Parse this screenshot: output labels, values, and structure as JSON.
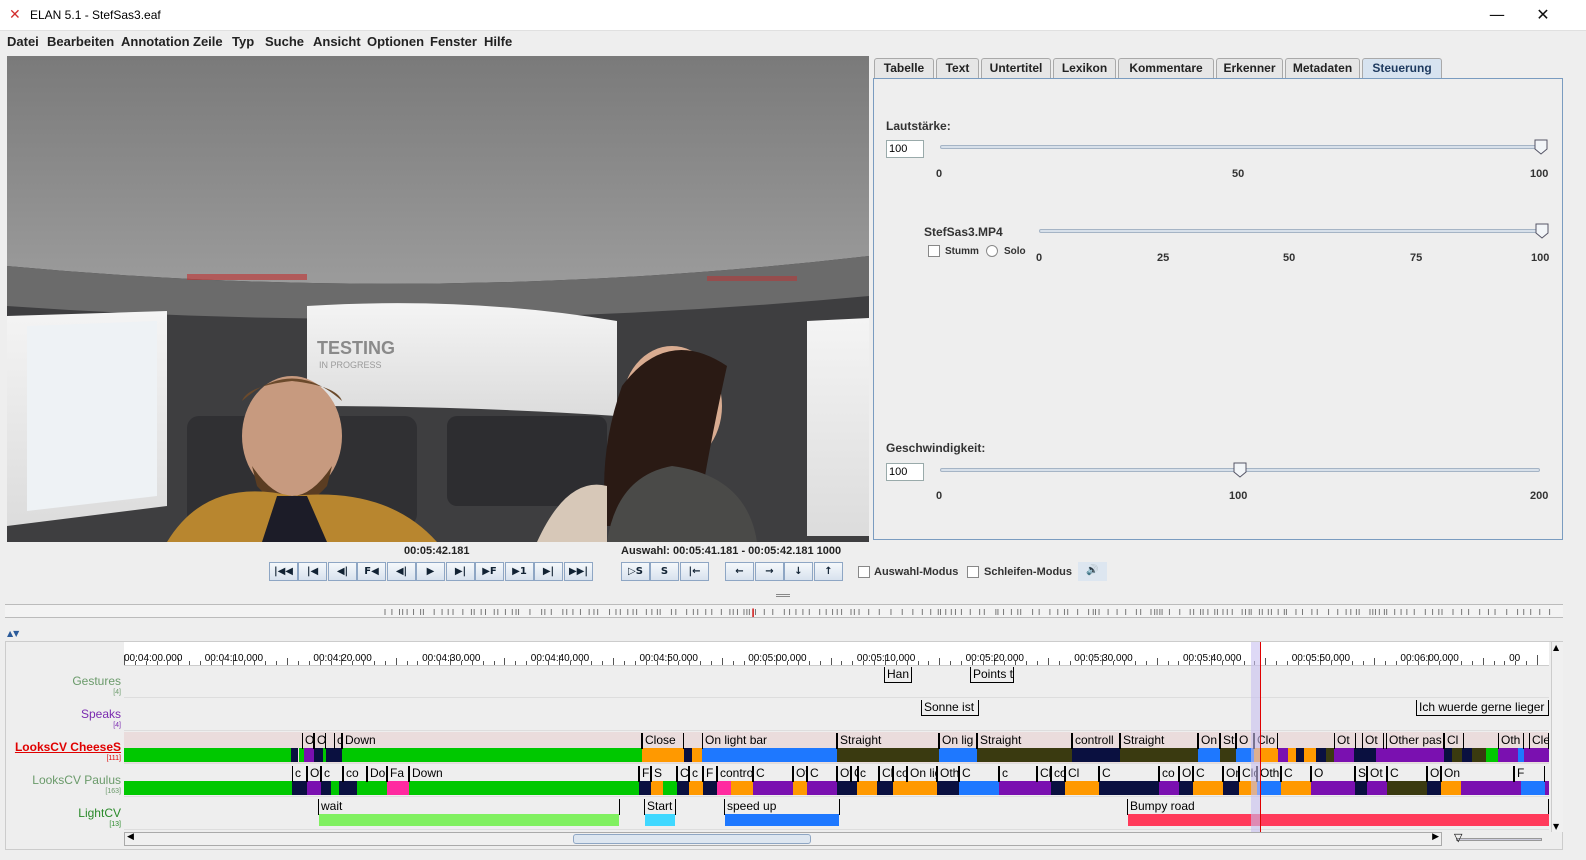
{
  "window": {
    "title": "ELAN 5.1 - StefSas3.eaf",
    "minimize": "—",
    "maximize": "☐",
    "close": "✕"
  },
  "menu": [
    "Datei",
    "Bearbeiten",
    "Annotation",
    "Zeile",
    "Typ",
    "Suche",
    "Ansicht",
    "Optionen",
    "Fenster",
    "Hilfe"
  ],
  "video": {
    "sign_line1": "TESTING",
    "sign_line2": "IN PROGRESS"
  },
  "tabs": [
    "Tabelle",
    "Text",
    "Untertitel",
    "Lexikon",
    "Kommentare",
    "Erkenner",
    "Metadaten",
    "Steuerung"
  ],
  "active_tab": "Steuerung",
  "controls": {
    "volume_label": "Lautstärke:",
    "volume_value": "100",
    "volume_ticks": [
      "0",
      "50",
      "100"
    ],
    "media_name": "StefSas3.MP4",
    "mute_label": "Stumm",
    "solo_label": "Solo",
    "media_ticks": [
      "0",
      "25",
      "50",
      "75",
      "100"
    ],
    "speed_label": "Geschwindigkeit:",
    "speed_value": "100",
    "speed_ticks": [
      "0",
      "100",
      "200"
    ]
  },
  "player": {
    "current_time": "00:05:42.181",
    "selection": "Auswahl: 00:05:41.181 - 00:05:42.181  1000",
    "auswahl_modus": "Auswahl-Modus",
    "schleifen_modus": "Schleifen-Modus",
    "buttons": [
      "|◀◀",
      "|◀",
      "◀|",
      "F◀",
      "◀|",
      "▶",
      "▶|",
      "▶F",
      "▶1",
      "▶|",
      "▶▶|"
    ],
    "sel_buttons": [
      "▷S",
      "S",
      "|←"
    ],
    "nav_buttons": [
      "←",
      "→",
      "↓",
      "↑"
    ]
  },
  "ruler_labels": [
    "00:04:00.000",
    "00:04:10.000",
    "00:04:20.000",
    "00:04:30.000",
    "00:04:40.000",
    "00:04:50.000",
    "00:05:00.000",
    "00:05:10.000",
    "00:05:20.000",
    "00:05:30.000",
    "00:05:40.000",
    "00:05:50.000",
    "00:06:00.000",
    "00"
  ],
  "tiers": [
    {
      "name": "Gestures",
      "count": "[4]",
      "color": "#6a9a6a"
    },
    {
      "name": "Speaks",
      "count": "[4]",
      "color": "#7a2ab0"
    },
    {
      "name": "LooksCV CheeseS",
      "count": "[111]",
      "color": "#e00000"
    },
    {
      "name": "LooksCV Paulus",
      "count": "[163]",
      "color": "#6a9a6a"
    },
    {
      "name": "LightCV",
      "count": "[13]",
      "color": "#2a8a2a"
    }
  ],
  "gestures": [
    "Han",
    "Points t"
  ],
  "speaks": [
    "Sonne ist",
    "Ich wuerde gerne lieger"
  ],
  "cheese_labels": [
    "O",
    "O",
    "c",
    "Down",
    "Close",
    "On light bar",
    "Straight",
    "On lig",
    "Straight",
    "controll",
    "Straight",
    "On",
    "St",
    "O",
    "Clo",
    "Ot",
    "Ot",
    "Other pas",
    "Cl",
    "Oth",
    "Cle"
  ],
  "paulus_labels": [
    "c",
    "Ot",
    "c",
    "co",
    "Do",
    "Fa",
    "Down",
    "F",
    "S",
    "Cl",
    "c",
    "F",
    "control",
    "C",
    "Oth",
    "C",
    "Ot",
    "Clo",
    "c",
    "Clo",
    "co",
    "On lig",
    "Other",
    "C",
    "c",
    "Clos",
    "controll",
    "Cl",
    "C",
    "co",
    "O",
    "C",
    "On",
    "Clo",
    "Other",
    "C",
    "O",
    "Straig",
    "Ot",
    "C",
    "Other pas",
    "On",
    "F"
  ],
  "light_labels": [
    "wait",
    "Start",
    "speed up",
    "Bumpy road"
  ],
  "colors": {
    "green": "#00c800",
    "orange": "#ff9900",
    "blue": "#1e78ff",
    "purple": "#7a10b0",
    "navy": "#0a1040",
    "olive": "#3a3a10",
    "pink": "#ff2aa0",
    "red": "#ff3a5a",
    "lightgreen": "#80f060",
    "cyan": "#40d8ff",
    "cursor": "#e00000"
  }
}
